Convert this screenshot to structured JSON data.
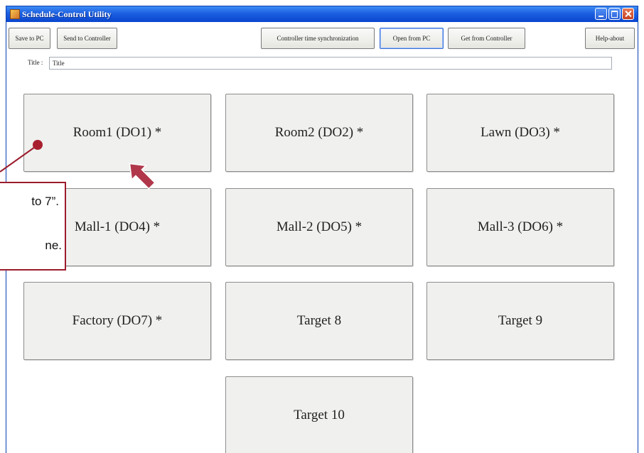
{
  "window": {
    "title": "Schedule-Control Utility"
  },
  "toolbar": {
    "save_pc": "Save to PC",
    "send_controller": "Send to Controller",
    "time_sync": "Controller time synchronization",
    "open_pc": "Open from PC",
    "get_controller": "Get from Controller",
    "help_about": "Help-about"
  },
  "title_field": {
    "label": "Title :",
    "value": "Title"
  },
  "targets": [
    "Room1 (DO1) *",
    "Room2 (DO2) *",
    "Lawn (DO3) *",
    "Mall-1 (DO4) *",
    "Mall-2 (DO5) *",
    "Mall-3 (DO6) *",
    "Factory (DO7) *",
    "Target 8",
    "Target 9",
    "Target 10"
  ],
  "callout": {
    "line1": "to 7”.",
    "line2": "ne."
  },
  "colors": {
    "callout_border": "#9b1c2c",
    "pointer_arrow": "#b0384a"
  }
}
